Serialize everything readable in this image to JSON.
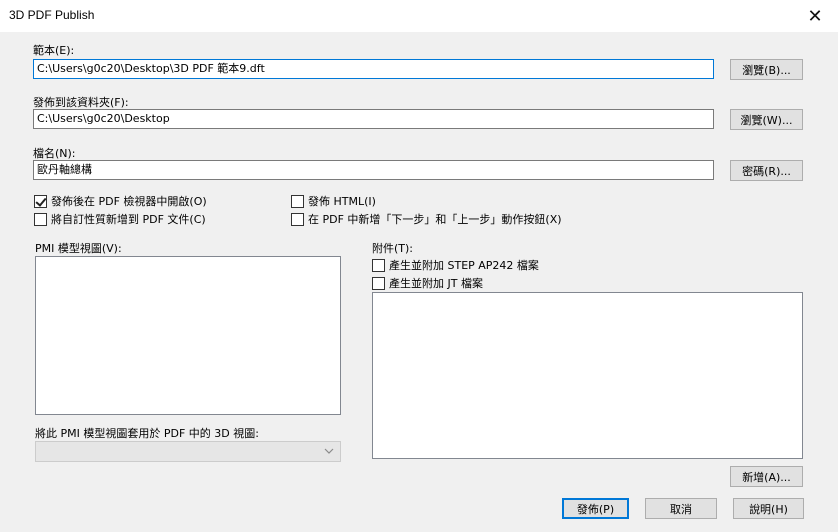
{
  "window": {
    "title": "3D PDF Publish",
    "close_glyph": "✕"
  },
  "template": {
    "label": "範本(E):",
    "value": "C:\\Users\\g0c20\\Desktop\\3D PDF 範本9.dft",
    "browse_label": "瀏覽(B)..."
  },
  "folder": {
    "label": "發佈到該資料夾(F):",
    "value": "C:\\Users\\g0c20\\Desktop",
    "browse_label": "瀏覽(W)..."
  },
  "filename": {
    "label": "檔名(N):",
    "value": "歐丹軸總構",
    "password_label": "密碼(R)..."
  },
  "options": {
    "open_after_publish": {
      "label": "發佈後在 PDF 檢視器中開啟(O)",
      "checked": true
    },
    "add_custom_props": {
      "label": "將自訂性質新增到 PDF 文件(C)",
      "checked": false
    },
    "publish_html": {
      "label": "發佈 HTML(I)",
      "checked": false
    },
    "add_nav_buttons": {
      "label": "在 PDF 中新增「下一步」和「上一步」動作按鈕(X)",
      "checked": false
    }
  },
  "pmi": {
    "label": "PMI 模型視圖(V):",
    "apply_label": "將此 PMI 模型視圖套用於 PDF 中的 3D 視圖:",
    "combo_value": ""
  },
  "attachments": {
    "label": "附件(T):",
    "step_label": "產生並附加 STEP AP242 檔案",
    "step_checked": false,
    "jt_label": "產生並附加 JT 檔案",
    "jt_checked": false,
    "add_label": "新增(A)..."
  },
  "footer": {
    "publish_label": "發佈(P)",
    "cancel_label": "取消",
    "help_label": "說明(H)"
  }
}
